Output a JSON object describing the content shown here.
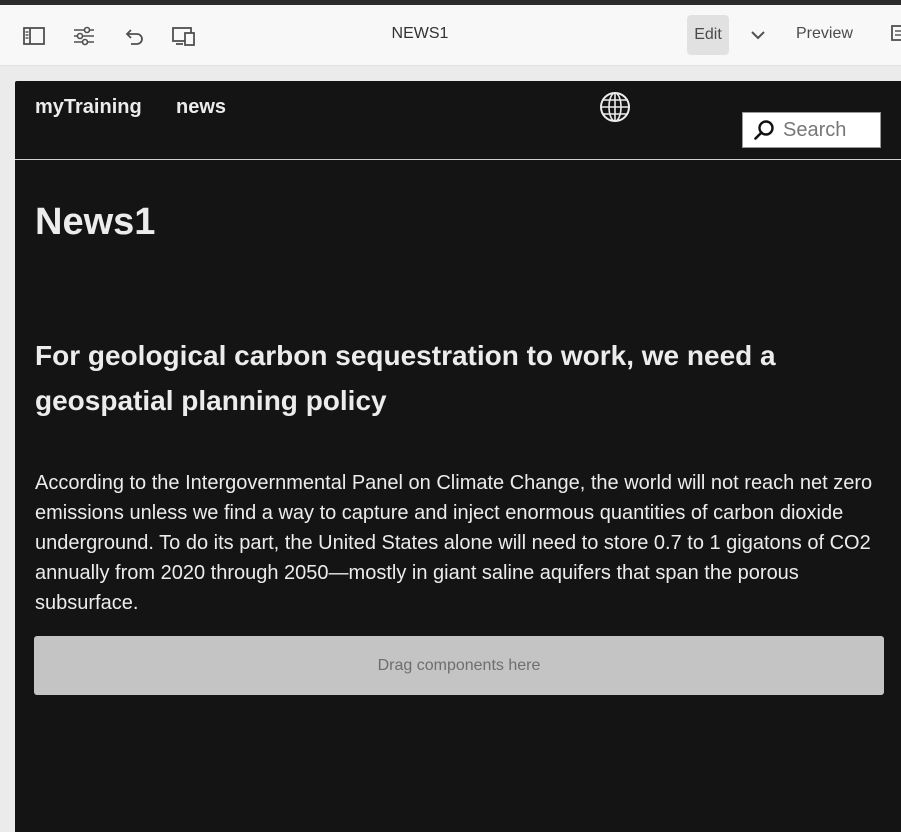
{
  "toolbar": {
    "icons": [
      "side-panel-icon",
      "page-properties-icon",
      "undo-icon",
      "emulator-icon"
    ],
    "page_name": "NEWS1",
    "edit_label": "Edit",
    "mode_dropdown_icon": "chevron-down-icon",
    "preview_label": "Preview"
  },
  "site": {
    "nav": [
      "myTraining",
      "news"
    ],
    "language_icon": "globe-icon",
    "search": {
      "placeholder": "Search"
    },
    "page_title": "News1",
    "headline": "For geological carbon sequestration to work, we need a geospatial planning policy",
    "body": "According to the Intergovernmental Panel on Climate Change, the world will not reach net zero emissions unless we find a way to capture and inject enormous quantities of carbon dioxide underground. To do its part, the United States alone will need to store 0.7 to 1 gigatons of CO2 annually from 2020 through 2050—mostly in giant saline aquifers that span the porous subsurface.",
    "drop_zone": "Drag components here"
  },
  "colors": {
    "site_background": "#141414",
    "site_text": "#ececec",
    "toolbar_background": "#f8f8f8",
    "drop_zone": "#c4c4c4"
  }
}
